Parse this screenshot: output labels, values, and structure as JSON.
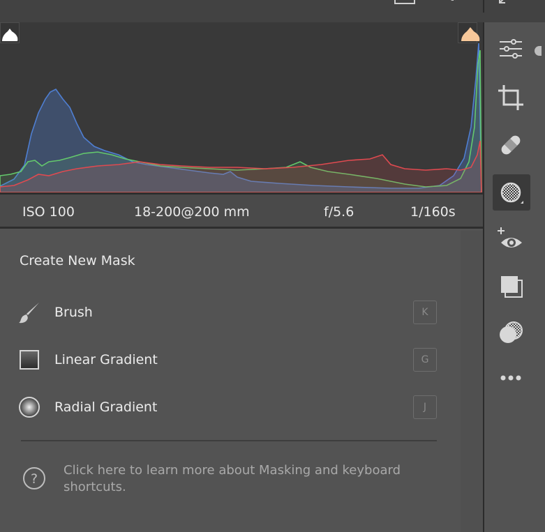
{
  "exif": {
    "iso": "ISO 100",
    "lens": "18-200@200 mm",
    "aperture": "f/5.6",
    "shutter": "1/160s"
  },
  "mask_panel": {
    "title": "Create New Mask",
    "tools": [
      {
        "label": "Brush",
        "shortcut": "K",
        "icon": "brush-icon"
      },
      {
        "label": "Linear Gradient",
        "shortcut": "G",
        "icon": "linear-gradient-icon"
      },
      {
        "label": "Radial Gradient",
        "shortcut": "J",
        "icon": "radial-gradient-icon"
      }
    ],
    "help_text": "Click here to learn more about Masking and keyboard shortcuts."
  },
  "tool_rail": {
    "icons": [
      "sliders-icon",
      "crop-icon",
      "healing-icon",
      "masking-icon",
      "red-eye-icon",
      "presets-icon",
      "mix-icon",
      "more-icon"
    ],
    "active": "masking-icon"
  },
  "histogram": {
    "shadow_clip_warning_color": "#ffffff",
    "highlight_clip_warning_color": "#f7c89a",
    "channel_colors": {
      "blue": "#4a78c8",
      "green": "#63c86a",
      "red": "#e0464c"
    }
  }
}
